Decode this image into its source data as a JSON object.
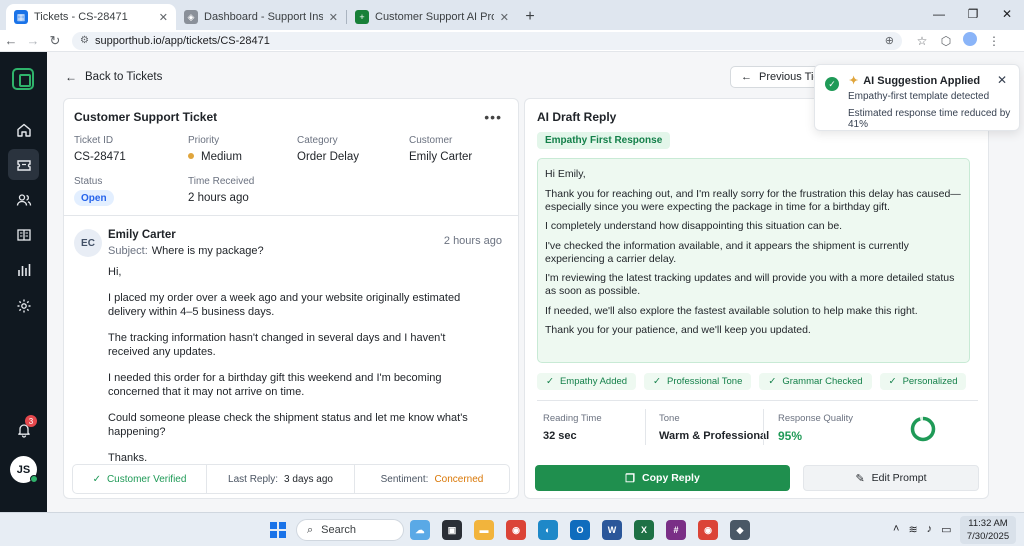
{
  "browser": {
    "tabs": [
      {
        "label": "Tickets - CS-28471",
        "favicon_color": "#1a73e8",
        "active": true
      },
      {
        "label": "Dashboard - Support Insights",
        "favicon_color": "#5f6368",
        "active": false
      },
      {
        "label": "Customer Support AI Prompts - G",
        "favicon_color": "#188038",
        "active": false
      }
    ],
    "url": "supporthub.io/app/tickets/CS-28471"
  },
  "sidebar": {
    "items": [
      {
        "icon": "home-icon"
      },
      {
        "icon": "ticket-icon",
        "active": true
      },
      {
        "icon": "users-icon"
      },
      {
        "icon": "book-icon"
      },
      {
        "icon": "bar-chart-icon"
      },
      {
        "icon": "gear-icon"
      }
    ],
    "notification_count": "3",
    "user_initials": "JS"
  },
  "header": {
    "back_label": "Back to Tickets",
    "prev_label": "Previous Ticket"
  },
  "ticket": {
    "title": "Customer Support Ticket",
    "fields": {
      "ticket_id_label": "Ticket ID",
      "ticket_id": "CS-28471",
      "priority_label": "Priority",
      "priority": "Medium",
      "priority_color": "#e0a53c",
      "category_label": "Category",
      "category": "Order Delay",
      "customer_label": "Customer",
      "customer": "Emily Carter",
      "status_label": "Status",
      "status": "Open",
      "time_label": "Time Received",
      "time": "2 hours ago"
    },
    "message": {
      "avatar": "EC",
      "sender": "Emily Carter",
      "time": "2 hours ago",
      "subject_label": "Subject:",
      "subject": "Where is my package?",
      "body": [
        "Hi,",
        "I placed my order over a week ago and your website originally estimated delivery within 4–5 business days.",
        "The tracking information hasn't changed in several days and I haven't received any updates.",
        "I needed this order for a birthday gift this weekend and I'm becoming concerned that it may not arrive on time.",
        "Could someone please check the shipment status and let me know what's happening?",
        "Thanks."
      ]
    },
    "footer": {
      "verified": "Customer Verified",
      "last_reply_label": "Last Reply:",
      "last_reply": "3 days ago",
      "sentiment_label": "Sentiment:",
      "sentiment": "Concerned"
    }
  },
  "reply": {
    "title": "AI Draft Reply",
    "template_tag": "Empathy First Response",
    "body": [
      "Hi Emily,",
      "Thank you for reaching out, and I'm really sorry for the frustration this delay has caused—especially since you were expecting the package in time for a birthday gift.",
      "I completely understand how disappointing this situation can be.",
      "I've checked the information available, and it appears the shipment is currently experiencing a carrier delay.",
      "I'm reviewing the latest tracking updates and will provide you with a more detailed status as soon as possible.",
      "If needed, we'll also explore the fastest available solution to help make this right.",
      "Thank you for your patience, and we'll keep you updated."
    ],
    "checks": [
      "Empathy Added",
      "Professional Tone",
      "Grammar Checked",
      "Personalized"
    ],
    "stats": {
      "reading_time_label": "Reading Time",
      "reading_time": "32 sec",
      "tone_label": "Tone",
      "tone": "Warm & Professional",
      "quality_label": "Response Quality",
      "quality": "95%",
      "quality_fraction": 0.95
    },
    "copy_label": "Copy Reply",
    "edit_label": "Edit Prompt"
  },
  "toast": {
    "title": "AI Suggestion Applied",
    "line1": "Empathy-first template detected",
    "line2": "Estimated response time reduced by 41%"
  },
  "taskbar": {
    "search": "Search",
    "time": "11:32 AM",
    "date": "7/30/2025"
  },
  "colors": {
    "accent_green": "#1f8f4e",
    "rail_bg": "#101820",
    "status_blue": "#2563eb"
  }
}
